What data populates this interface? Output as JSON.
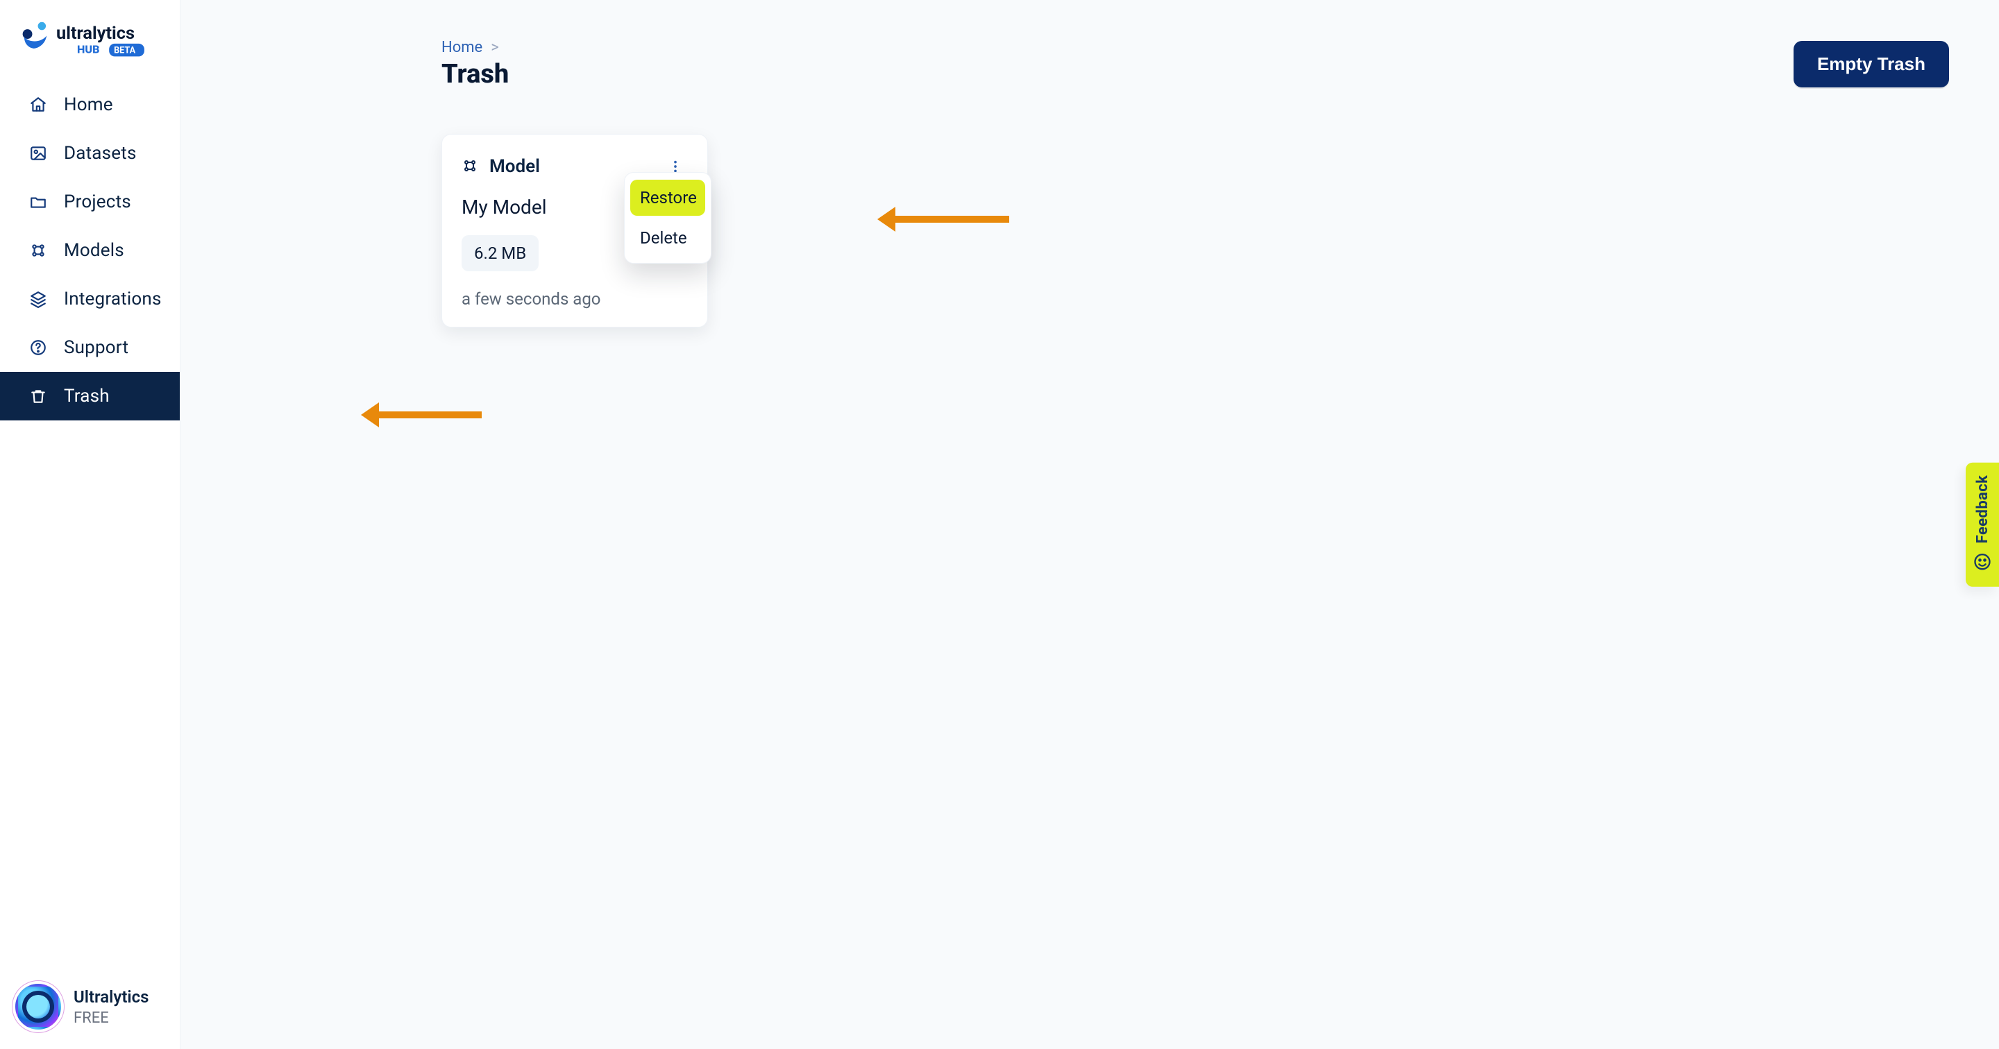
{
  "logo": {
    "brand": "ultralytics",
    "sub": "HUB",
    "badge": "BETA"
  },
  "sidebar": {
    "items": [
      {
        "label": "Home",
        "icon": "home-icon",
        "active": false
      },
      {
        "label": "Datasets",
        "icon": "image-icon",
        "active": false
      },
      {
        "label": "Projects",
        "icon": "folder-icon",
        "active": false
      },
      {
        "label": "Models",
        "icon": "models-icon",
        "active": false
      },
      {
        "label": "Integrations",
        "icon": "layers-icon",
        "active": false
      },
      {
        "label": "Support",
        "icon": "help-icon",
        "active": false
      },
      {
        "label": "Trash",
        "icon": "trash-icon",
        "active": true
      }
    ]
  },
  "account": {
    "name": "Ultralytics",
    "plan": "FREE"
  },
  "header": {
    "breadcrumb": {
      "root": "Home",
      "sep": ">"
    },
    "title": "Trash",
    "emptyButton": "Empty Trash"
  },
  "card": {
    "typeLabel": "Model",
    "name": "My Model",
    "size": "6.2 MB",
    "since": "a few seconds ago",
    "menu": {
      "restore": "Restore",
      "delete": "Delete"
    }
  },
  "feedback": {
    "label": "Feedback"
  }
}
